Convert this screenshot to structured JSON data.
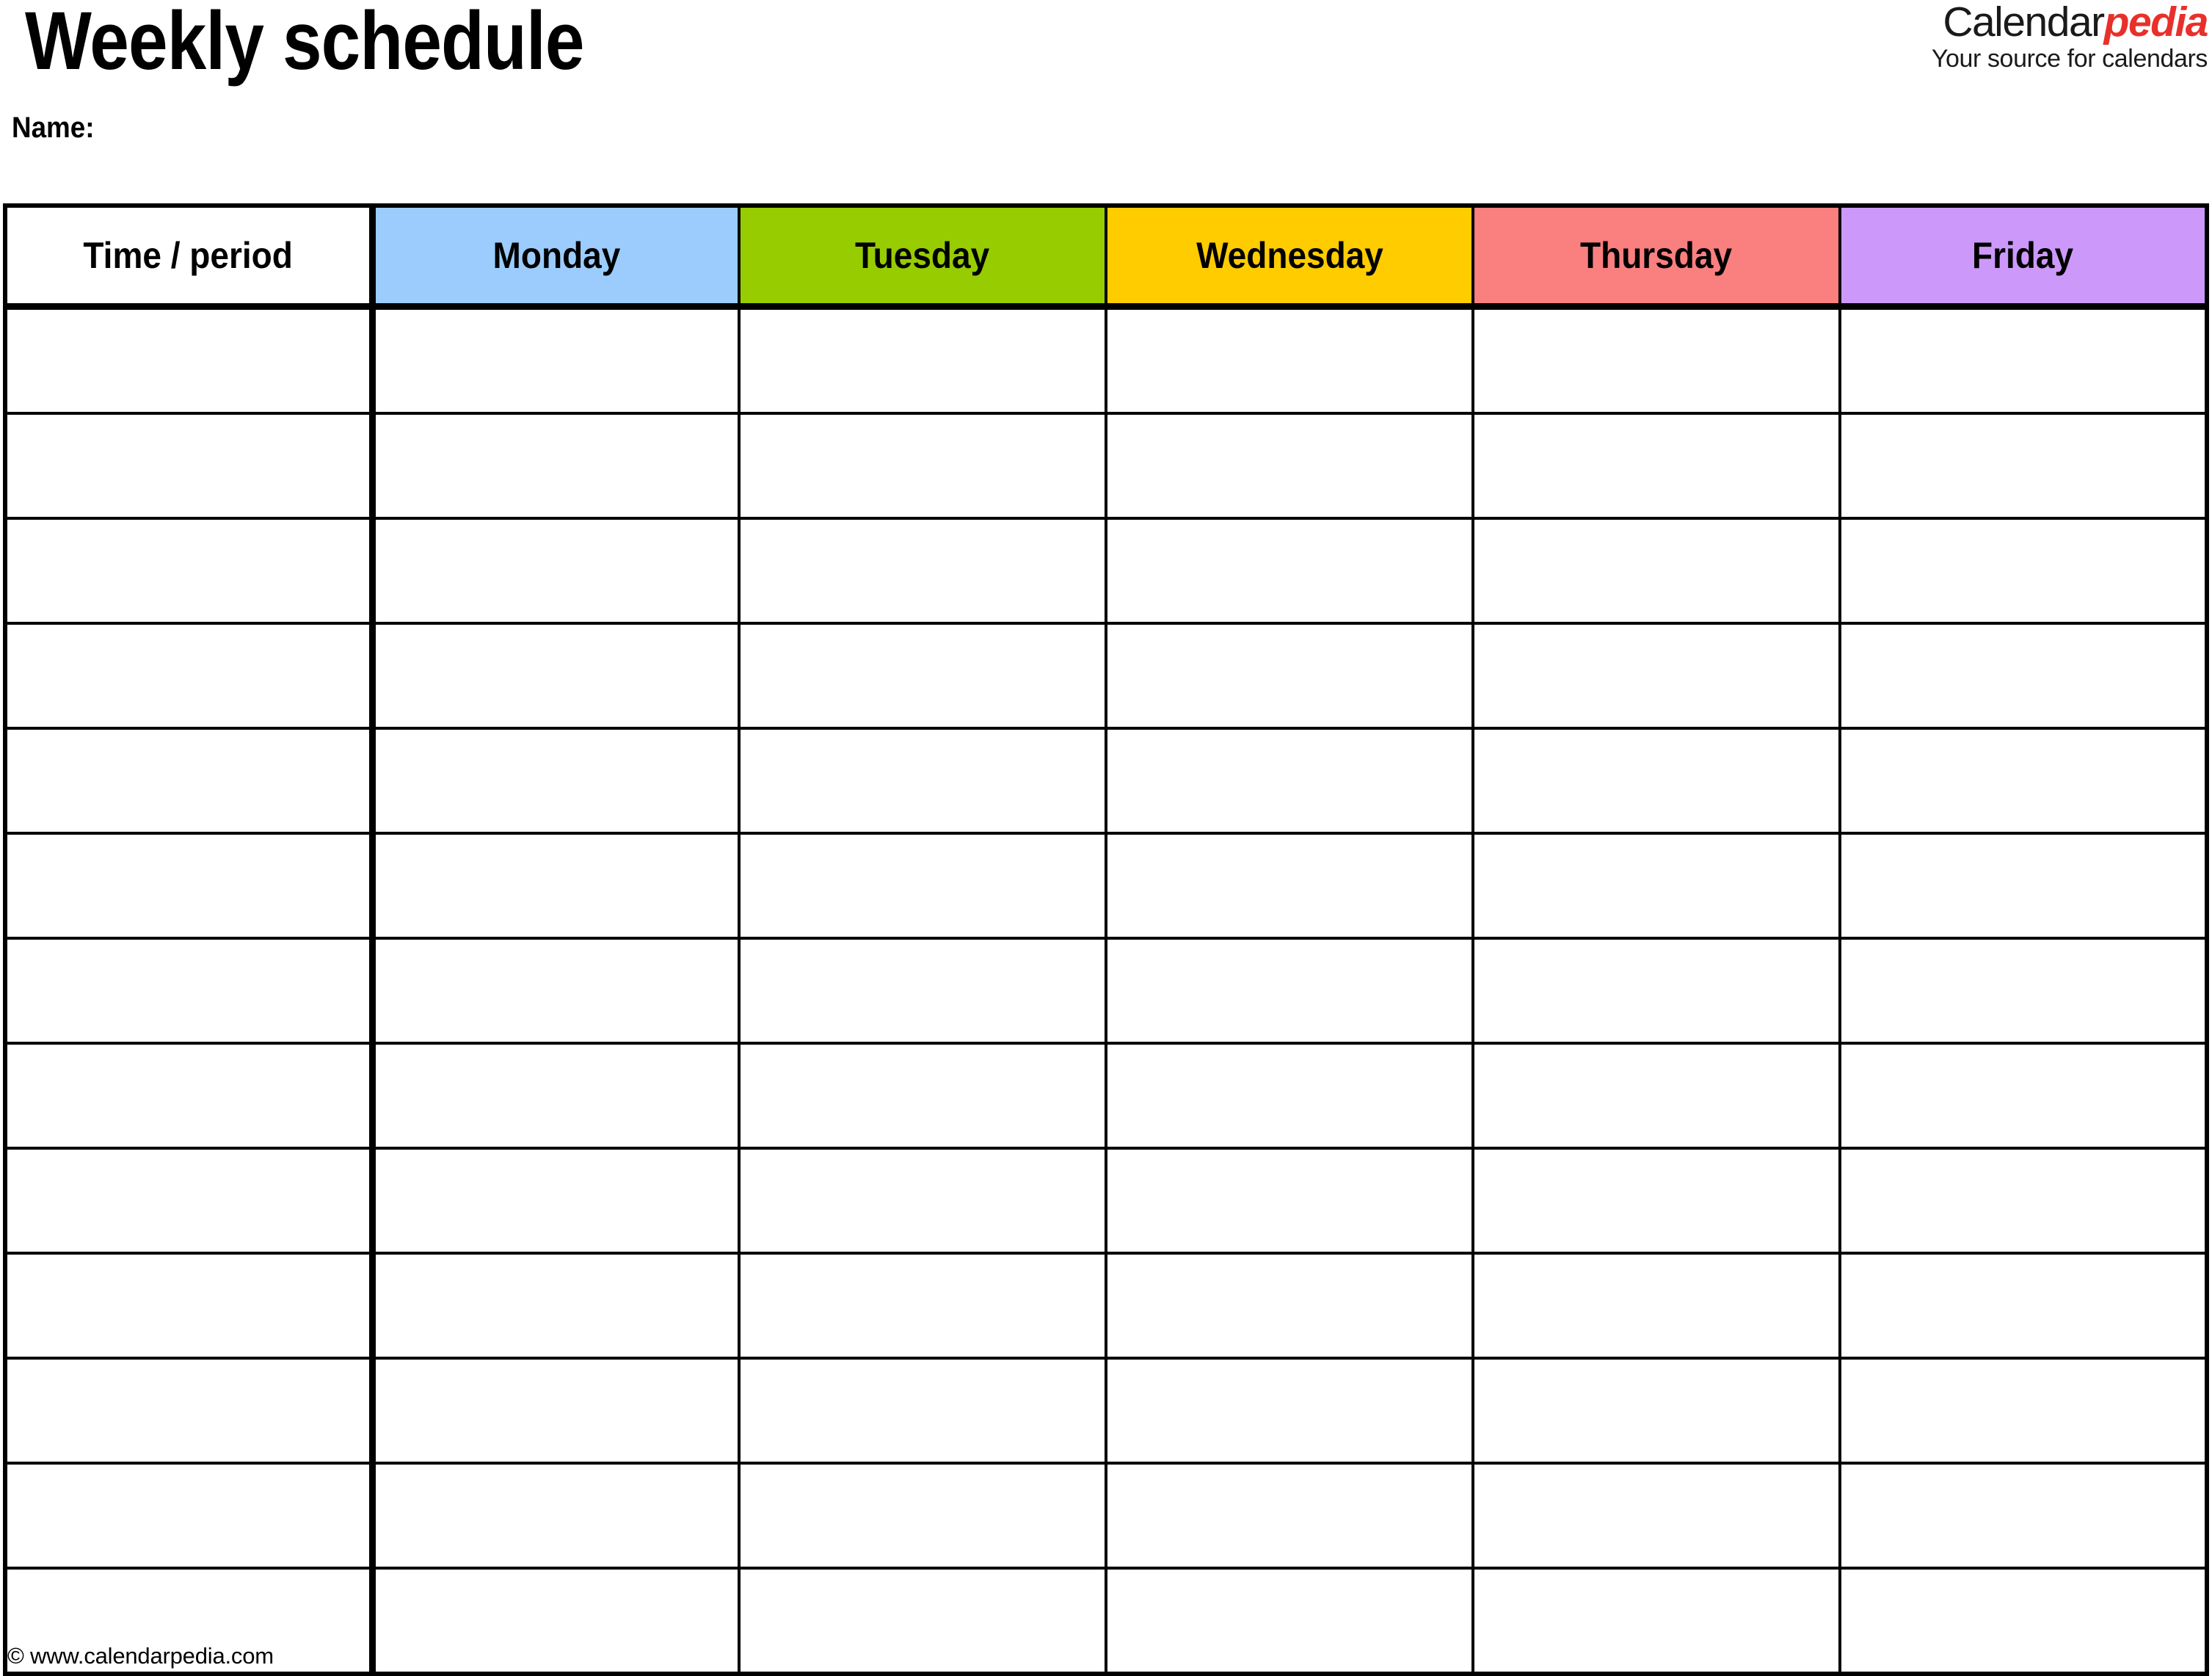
{
  "document": {
    "title": "Weekly schedule",
    "name_label": "Name:"
  },
  "logo": {
    "word_primary": "Calendar",
    "word_accent": "pedia",
    "tagline": "Your source for calendars",
    "accent_color": "#e8302a",
    "primary_color": "#1a1a1a"
  },
  "table": {
    "columns": [
      {
        "label": "Time / period",
        "color": "#ffffff",
        "is_time_column": true
      },
      {
        "label": "Monday",
        "color": "#9bccfd",
        "is_time_column": false
      },
      {
        "label": "Tuesday",
        "color": "#97cc00",
        "is_time_column": false
      },
      {
        "label": "Wednesday",
        "color": "#ffcc00",
        "is_time_column": false
      },
      {
        "label": "Thursday",
        "color": "#fa7f7f",
        "is_time_column": false
      },
      {
        "label": "Friday",
        "color": "#cc99fa",
        "is_time_column": false
      }
    ],
    "row_count": 13,
    "rows": [
      [
        "",
        "",
        "",
        "",
        "",
        ""
      ],
      [
        "",
        "",
        "",
        "",
        "",
        ""
      ],
      [
        "",
        "",
        "",
        "",
        "",
        ""
      ],
      [
        "",
        "",
        "",
        "",
        "",
        ""
      ],
      [
        "",
        "",
        "",
        "",
        "",
        ""
      ],
      [
        "",
        "",
        "",
        "",
        "",
        ""
      ],
      [
        "",
        "",
        "",
        "",
        "",
        ""
      ],
      [
        "",
        "",
        "",
        "",
        "",
        ""
      ],
      [
        "",
        "",
        "",
        "",
        "",
        ""
      ],
      [
        "",
        "",
        "",
        "",
        "",
        ""
      ],
      [
        "",
        "",
        "",
        "",
        "",
        ""
      ],
      [
        "",
        "",
        "",
        "",
        "",
        ""
      ],
      [
        "",
        "",
        "",
        "",
        "",
        ""
      ]
    ]
  },
  "footer": {
    "credit": "© www.calendarpedia.com"
  }
}
